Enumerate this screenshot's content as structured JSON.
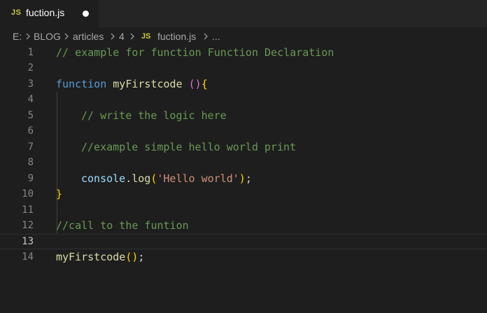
{
  "tab": {
    "badge": "JS",
    "filename": "fuction.js"
  },
  "breadcrumb": {
    "parts": [
      "E:",
      "BLOG",
      "articles",
      "4"
    ],
    "file_badge": "JS",
    "file": "fuction.js",
    "trailing": "..."
  },
  "editor": {
    "active_line": 13,
    "line_numbers": [
      "1",
      "2",
      "3",
      "4",
      "5",
      "6",
      "7",
      "8",
      "9",
      "10",
      "11",
      "12",
      "13",
      "14"
    ],
    "lines": {
      "l1_comment": "// example for function Function Declaration",
      "l3_keyword": "function",
      "l3_name": "myFirstcode",
      "l3_parens": "()",
      "l3_brace": "{",
      "l5_comment": "// write the logic here",
      "l7_comment": "//example simple hello world print",
      "l9_obj": "console",
      "l9_dot": ".",
      "l9_method": "log",
      "l9_open": "(",
      "l9_string": "'Hello world'",
      "l9_close": ")",
      "l9_semi": ";",
      "l10_brace": "}",
      "l12_comment": "//call to the funtion",
      "l14_name": "myFirstcode",
      "l14_parens": "()",
      "l14_semi": ";"
    }
  },
  "colors": {
    "background": "#1e1e1e",
    "comment": "#6a9955",
    "keyword": "#569cd6",
    "function": "#dcdcaa",
    "string": "#ce9178",
    "js_badge": "#cbcb41"
  }
}
